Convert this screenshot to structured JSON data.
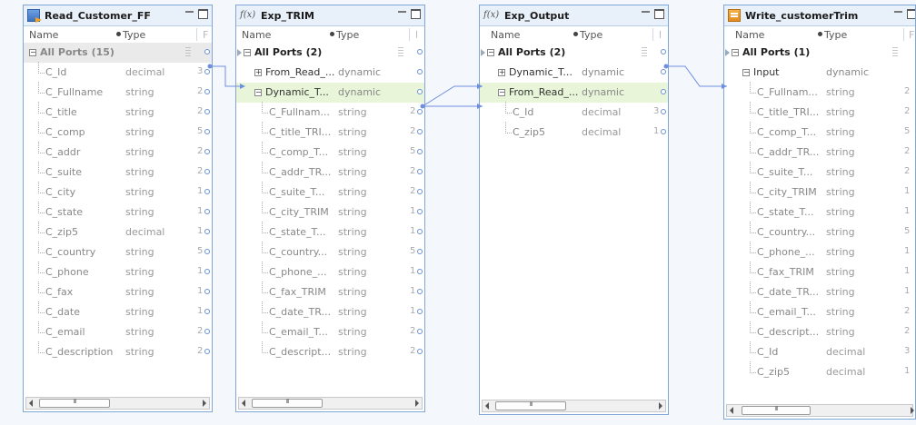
{
  "columns": {
    "name": "Name",
    "type": "Type"
  },
  "panels": [
    {
      "id": "read",
      "icon": "source-transformation-icon",
      "title": "Read_Customer_FF",
      "rows": [
        {
          "name": "All Ports (15)",
          "type": "",
          "kind": "top"
        },
        {
          "name": "C_Id",
          "type": "decimal",
          "num": "3"
        },
        {
          "name": "C_Fullname",
          "type": "string",
          "num": "2"
        },
        {
          "name": "C_title",
          "type": "string",
          "num": "2"
        },
        {
          "name": "C_comp",
          "type": "string",
          "num": "5"
        },
        {
          "name": "C_addr",
          "type": "string",
          "num": "2"
        },
        {
          "name": "C_suite",
          "type": "string",
          "num": "2"
        },
        {
          "name": "C_city",
          "type": "string",
          "num": "1"
        },
        {
          "name": "C_state",
          "type": "string",
          "num": "1"
        },
        {
          "name": "C_zip5",
          "type": "decimal",
          "num": "1"
        },
        {
          "name": "C_country",
          "type": "string",
          "num": "5"
        },
        {
          "name": "C_phone",
          "type": "string",
          "num": "1"
        },
        {
          "name": "C_fax",
          "type": "string",
          "num": "1"
        },
        {
          "name": "C_date",
          "type": "string",
          "num": "1"
        },
        {
          "name": "C_email",
          "type": "string",
          "num": "2"
        },
        {
          "name": "C_description",
          "type": "string",
          "num": "2"
        }
      ]
    },
    {
      "id": "trim",
      "icon": "expression-fx-icon",
      "title": "Exp_TRIM",
      "rows": [
        {
          "name": "All Ports (2)",
          "type": "",
          "kind": "port"
        },
        {
          "name": "From_Read_...",
          "type": "dynamic",
          "kind": "group-plus"
        },
        {
          "name": "Dynamic_T...",
          "type": "dynamic",
          "kind": "group-minus-sel"
        },
        {
          "name": "C_Fullnam...",
          "type": "string",
          "num": "2"
        },
        {
          "name": "C_title_TRI...",
          "type": "string",
          "num": "2"
        },
        {
          "name": "C_comp_T...",
          "type": "string",
          "num": "5"
        },
        {
          "name": "C_addr_TR...",
          "type": "string",
          "num": "2"
        },
        {
          "name": "C_suite_T...",
          "type": "string",
          "num": "2"
        },
        {
          "name": "C_city_TRIM",
          "type": "string",
          "num": "1"
        },
        {
          "name": "C_state_T...",
          "type": "string",
          "num": "1"
        },
        {
          "name": "C_country...",
          "type": "string",
          "num": "5"
        },
        {
          "name": "C_phone_...",
          "type": "string",
          "num": "1"
        },
        {
          "name": "C_fax_TRIM",
          "type": "string",
          "num": "1"
        },
        {
          "name": "C_date_TR...",
          "type": "string",
          "num": "1"
        },
        {
          "name": "C_email_T...",
          "type": "string",
          "num": "2"
        },
        {
          "name": "C_descript...",
          "type": "string",
          "num": "2"
        }
      ]
    },
    {
      "id": "out",
      "icon": "expression-fx-icon",
      "title": "Exp_Output",
      "rows": [
        {
          "name": "All Ports (2)",
          "type": "",
          "kind": "port"
        },
        {
          "name": "Dynamic_T...",
          "type": "dynamic",
          "kind": "group-plus"
        },
        {
          "name": "From_Read_...",
          "type": "dynamic",
          "kind": "group-minus-sel"
        },
        {
          "name": "C_Id",
          "type": "decimal",
          "num": "3"
        },
        {
          "name": "C_zip5",
          "type": "decimal",
          "num": "1"
        }
      ]
    },
    {
      "id": "write",
      "icon": "target-transformation-icon",
      "title": "Write_customerTrim",
      "rows": [
        {
          "name": "All Ports (1)",
          "type": "",
          "kind": "port"
        },
        {
          "name": "Input",
          "type": "dynamic",
          "kind": "group-minus"
        },
        {
          "name": "C_Fullnam...",
          "type": "string",
          "num": "2"
        },
        {
          "name": "C_title_TRI...",
          "type": "string",
          "num": "2"
        },
        {
          "name": "C_comp_T...",
          "type": "string",
          "num": "5"
        },
        {
          "name": "C_addr_TR...",
          "type": "string",
          "num": "2"
        },
        {
          "name": "C_suite_T...",
          "type": "string",
          "num": "2"
        },
        {
          "name": "C_city_TRIM",
          "type": "string",
          "num": "1"
        },
        {
          "name": "C_state_T...",
          "type": "string",
          "num": "1"
        },
        {
          "name": "C_country...",
          "type": "string",
          "num": "5"
        },
        {
          "name": "C_phone_...",
          "type": "string",
          "num": "1"
        },
        {
          "name": "C_fax_TRIM",
          "type": "string",
          "num": "1"
        },
        {
          "name": "C_date_TR...",
          "type": "string",
          "num": "1"
        },
        {
          "name": "C_email_T...",
          "type": "string",
          "num": "2"
        },
        {
          "name": "C_descript...",
          "type": "string",
          "num": "2"
        },
        {
          "name": "C_Id",
          "type": "decimal",
          "num": "3"
        },
        {
          "name": "C_zip5",
          "type": "decimal",
          "num": "1"
        }
      ]
    }
  ],
  "colors": {
    "link": "#6e8fe0",
    "selected_row": "#e8f5d8",
    "panel_border": "#7fa6d4"
  }
}
